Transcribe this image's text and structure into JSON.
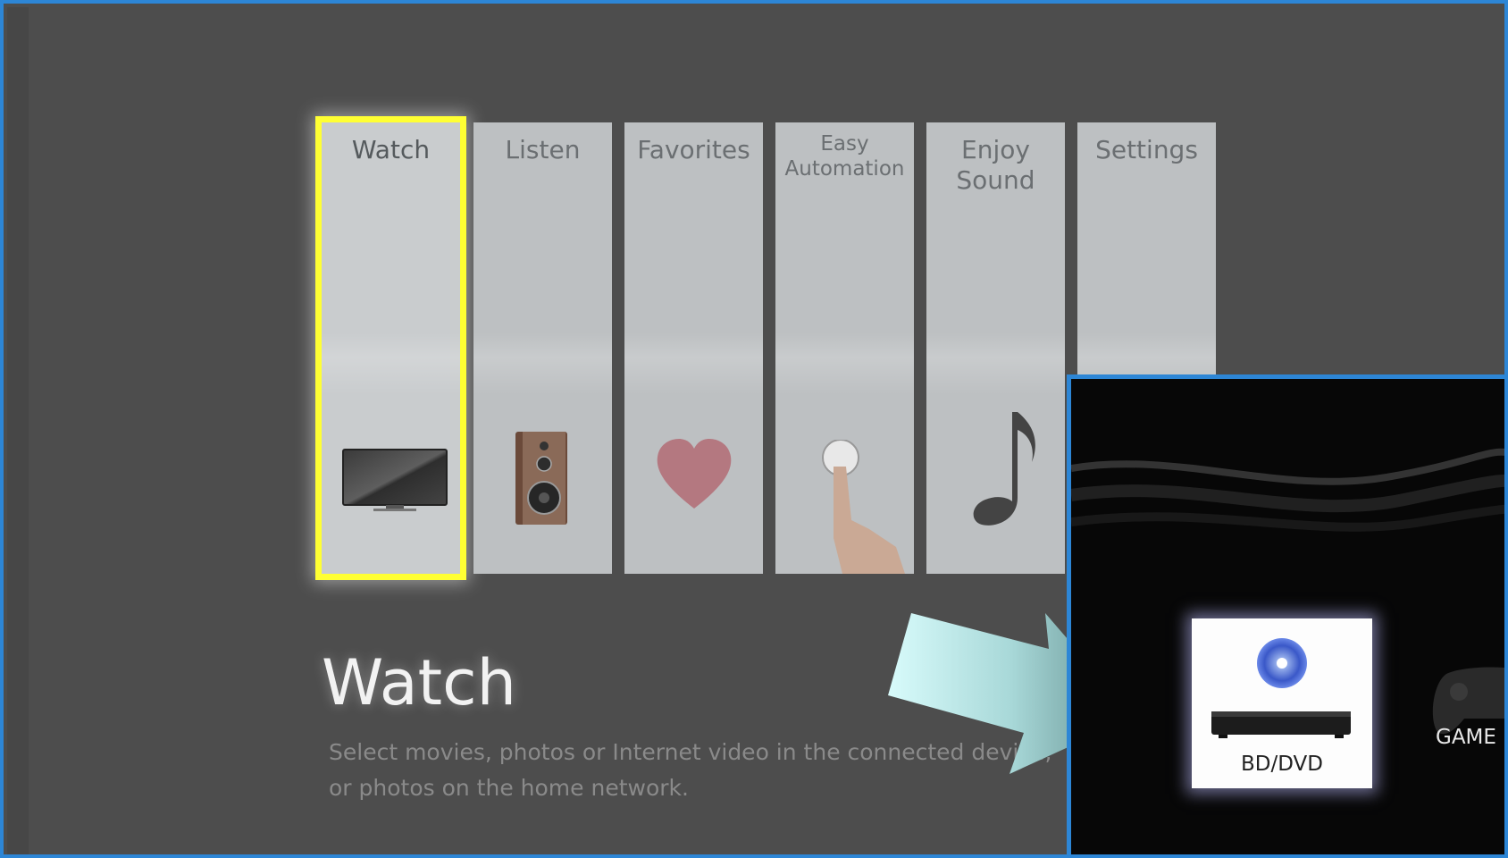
{
  "menu": {
    "items": [
      {
        "id": "watch",
        "label": "Watch",
        "icon": "tv-icon",
        "selected": true
      },
      {
        "id": "listen",
        "label": "Listen",
        "icon": "speaker-icon",
        "selected": false
      },
      {
        "id": "favorites",
        "label": "Favorites",
        "icon": "heart-icon",
        "selected": false
      },
      {
        "id": "easy-automation",
        "label": "Easy\nAutomation",
        "icon": "finger-button-icon",
        "selected": false
      },
      {
        "id": "enjoy-sound",
        "label": "Enjoy\nSound",
        "icon": "music-note-icon",
        "selected": false
      },
      {
        "id": "settings",
        "label": "Settings",
        "icon": "",
        "selected": false
      }
    ]
  },
  "detail": {
    "title": "Watch",
    "description": "Select movies, photos or Internet video in the connected device, or photos on the home network."
  },
  "popup": {
    "inputs": [
      {
        "label": "BD/DVD",
        "icon": "bd-dvd-player-icon",
        "selected": true
      },
      {
        "label": "GAME",
        "icon": "gamepad-icon",
        "selected": false
      }
    ]
  },
  "colors": {
    "highlight": "#ffff33",
    "frame_border": "#2d86d6",
    "background": "#4d4d4d"
  }
}
